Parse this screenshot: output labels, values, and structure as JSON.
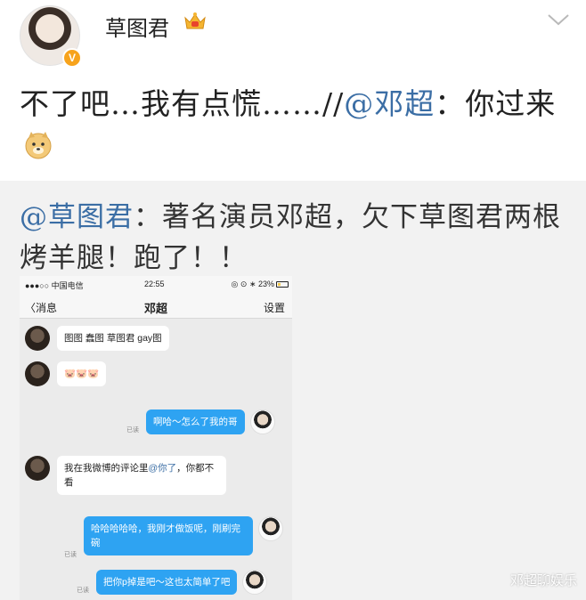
{
  "post": {
    "username": "草图君",
    "verified_badge": "V",
    "text_part1": "不了吧…我有点慌……//",
    "mention": "@邓超",
    "text_part2": "：你过来",
    "icons": [
      "crown-icon",
      "chevron-down-icon",
      "doge-emoji-icon"
    ]
  },
  "repost": {
    "mention": "@草图君",
    "text": "：著名演员邓超，欠下草图君两根烤羊腿！跑了！！"
  },
  "phone": {
    "status": {
      "carrier": "●●●○○ 中国电信 ",
      "time": "22:55",
      "battery": "◎ ⊙ ∗ 23%"
    },
    "nav": {
      "back": "〈消息",
      "title": "邓超",
      "settings": "设置"
    },
    "messages": [
      {
        "dir": "in",
        "text": "图图 蠢图 草图君 gay图"
      },
      {
        "dir": "in",
        "text": "🐷🐷🐷"
      },
      {
        "dir": "out",
        "text": "啊哈～怎么了我的哥",
        "read": "已读"
      },
      {
        "dir": "in",
        "text_a": "我在我微博的评论里",
        "mention": "@你了",
        "text_b": "，你都不看"
      },
      {
        "dir": "out",
        "text": "哈哈哈哈哈，我刚才做饭呢，刚刷完碗",
        "read": "已读"
      },
      {
        "dir": "out",
        "text": "把你p掉是吧～这也太简单了吧",
        "read": "已读"
      }
    ]
  },
  "watermark": "邓超聊娱乐",
  "colors": {
    "mention": "#3b6ea5",
    "repost_bg": "#f2f2f2",
    "bubble_out": "#2ea3f2",
    "badge": "#f7a31c"
  }
}
